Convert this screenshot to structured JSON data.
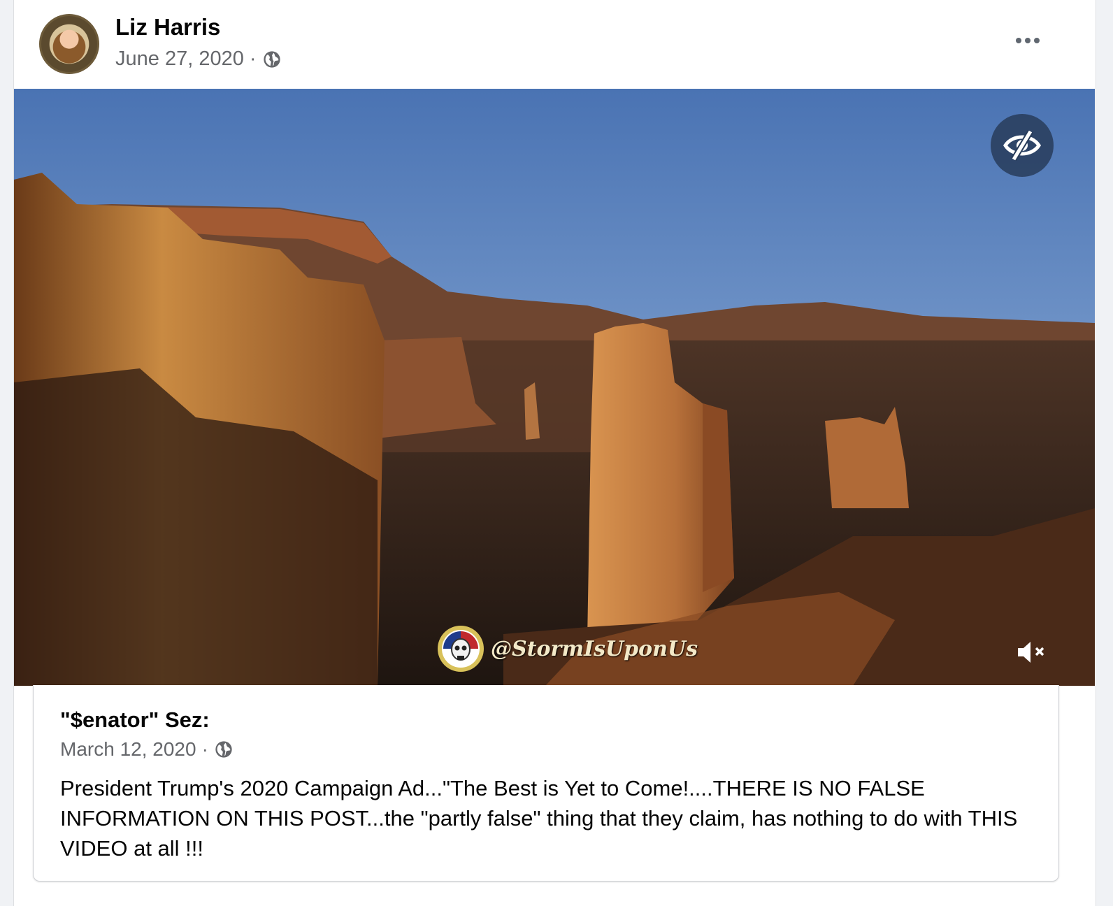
{
  "post": {
    "author": "Liz Harris",
    "date": "June 27, 2020",
    "separator": "·",
    "audience_icon": "globe-icon",
    "more_icon": "more-options-icon"
  },
  "video": {
    "hide_icon": "eye-slash-icon",
    "watermark_text": "@StormIsUponUs",
    "mute_icon": "speaker-muted-icon"
  },
  "shared_post": {
    "title": "\"$enator\" Sez:",
    "date": "March 12, 2020",
    "separator": "·",
    "audience_icon": "globe-icon",
    "body": "President Trump's 2020 Campaign Ad...\"The Best is Yet to Come!....THERE IS NO FALSE INFORMATION ON THIS POST...the \"partly false\" thing that they claim, has nothing to do with THIS VIDEO at all !!!"
  },
  "colors": {
    "primary_text": "#050505",
    "secondary_text": "#65676b",
    "background": "#f0f2f5"
  }
}
